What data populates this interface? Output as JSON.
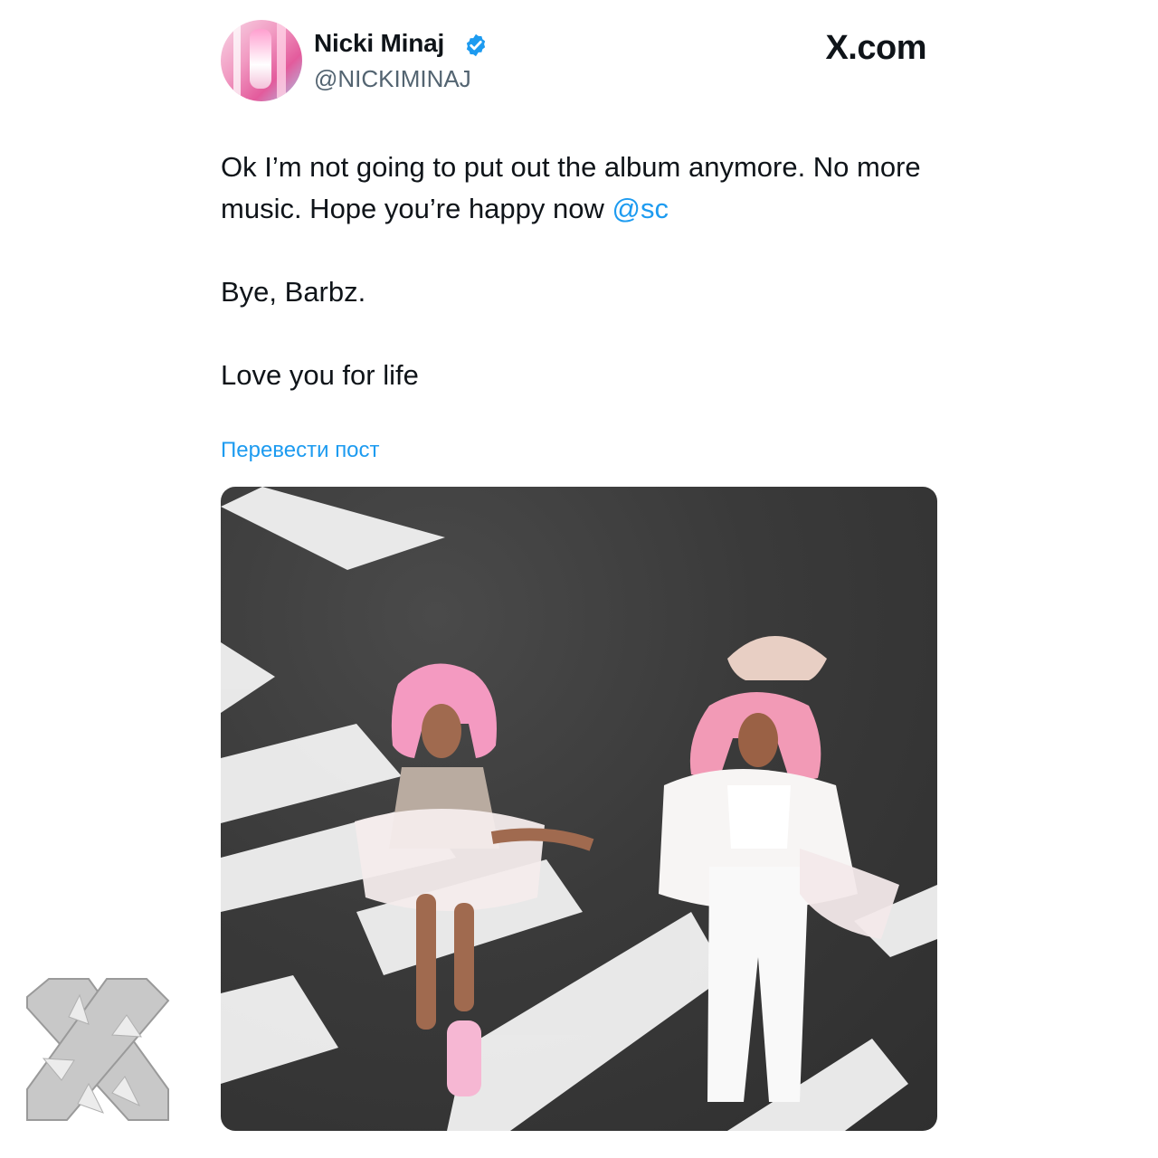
{
  "author": {
    "display_name": "Nicki Minaj",
    "handle": "@NICKIMINAJ",
    "verified": true,
    "avatar_icon": "profile-avatar"
  },
  "brand": "X.com",
  "post": {
    "line1_prefix": "Ok I’m not going to put out the album anymore. No more music. Hope you’re happy now ",
    "mention": "@sc",
    "line2": "Bye, Barbz.",
    "line3": "Love you for life"
  },
  "translate_label": "Перевести пост",
  "colors": {
    "link": "#1d9bf0",
    "verified_badge": "#1d9bf0",
    "text": "#0f1419",
    "secondary": "#536471"
  }
}
